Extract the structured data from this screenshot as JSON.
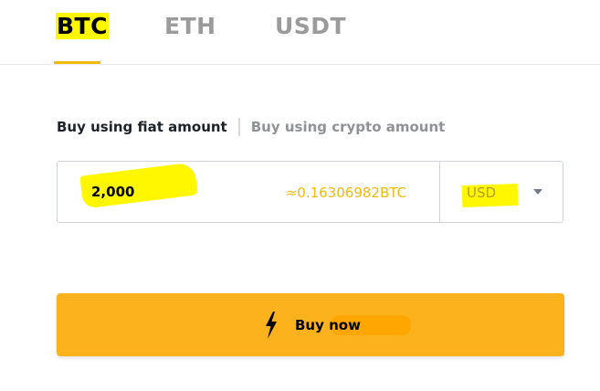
{
  "tabs": [
    {
      "label": "BTC",
      "active": true
    },
    {
      "label": "ETH",
      "active": false
    },
    {
      "label": "USDT",
      "active": false
    }
  ],
  "mode": {
    "fiat_label": "Buy using fiat amount",
    "crypto_label": "Buy using crypto amount",
    "selected": "fiat"
  },
  "amount": {
    "value": "2,000",
    "estimate": "≈0.16306982BTC",
    "currency": "USD"
  },
  "buy_button": {
    "label": "Buy now"
  },
  "colors": {
    "accent": "#f0b90b",
    "button": "#fcb21d",
    "highlight": "#fff700"
  },
  "icons": {
    "buy": "lightning-bolt-icon",
    "currency_dropdown": "caret-down-icon"
  }
}
